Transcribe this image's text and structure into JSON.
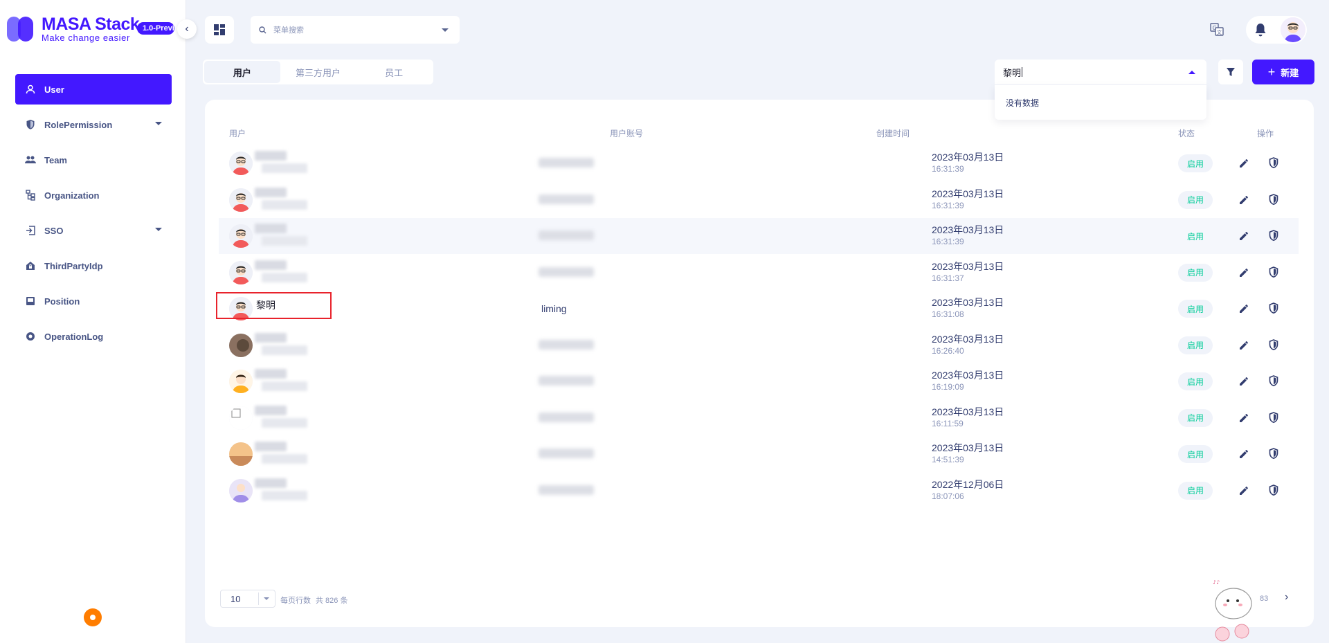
{
  "brand": {
    "title": "MASA Stack",
    "subtitle": "Make change easier",
    "version": "1.0-Preview",
    "accent": "#4318ff"
  },
  "sidebar": {
    "items": [
      {
        "label": "User",
        "icon": "user-icon",
        "active": true
      },
      {
        "label": "RolePermission",
        "icon": "shield-icon",
        "expandable": true
      },
      {
        "label": "Team",
        "icon": "team-icon"
      },
      {
        "label": "Organization",
        "icon": "organization-icon"
      },
      {
        "label": "SSO",
        "icon": "login-icon",
        "expandable": true
      },
      {
        "label": "ThirdPartyIdp",
        "icon": "home-lock-icon"
      },
      {
        "label": "Position",
        "icon": "position-icon"
      },
      {
        "label": "OperationLog",
        "icon": "record-icon"
      }
    ]
  },
  "topbar": {
    "menu_search_placeholder": "菜单搜索"
  },
  "tabs": [
    {
      "label": "用户",
      "active": true
    },
    {
      "label": "第三方用户",
      "active": false
    },
    {
      "label": "员工",
      "active": false
    }
  ],
  "search": {
    "value": "黎明",
    "dropdown_text": "没有数据"
  },
  "toolbar": {
    "new_label": "新建"
  },
  "table": {
    "headers": {
      "user": "用户",
      "account": "用户账号",
      "created": "创建时间",
      "status": "状态",
      "actions": "操作"
    },
    "rows": [
      {
        "name": "",
        "account": "",
        "date": "2023年03月13日",
        "time": "16:31:39",
        "status": "启用"
      },
      {
        "name": "",
        "account": "",
        "date": "2023年03月13日",
        "time": "16:31:39",
        "status": "启用"
      },
      {
        "name": "",
        "account": "",
        "date": "2023年03月13日",
        "time": "16:31:39",
        "status": "启用"
      },
      {
        "name": "",
        "account": "",
        "date": "2023年03月13日",
        "time": "16:31:37",
        "status": "启用"
      },
      {
        "name": "黎明",
        "account": "liming",
        "date": "2023年03月13日",
        "time": "16:31:08",
        "status": "启用"
      },
      {
        "name": "",
        "account": "",
        "date": "2023年03月13日",
        "time": "16:26:40",
        "status": "启用"
      },
      {
        "name": "",
        "account": "",
        "date": "2023年03月13日",
        "time": "16:19:09",
        "status": "启用"
      },
      {
        "name": "",
        "account": "",
        "date": "2023年03月13日",
        "time": "16:11:59",
        "status": "启用"
      },
      {
        "name": "",
        "account": "",
        "date": "2023年03月13日",
        "time": "14:51:39",
        "status": "启用"
      },
      {
        "name": "",
        "account": "",
        "date": "2022年12月06日",
        "time": "18:07:06",
        "status": "启用"
      }
    ]
  },
  "pagination": {
    "page_size": "10",
    "per_page_label": "每页行数",
    "total": "共 826 条",
    "page_fragment": "83"
  }
}
